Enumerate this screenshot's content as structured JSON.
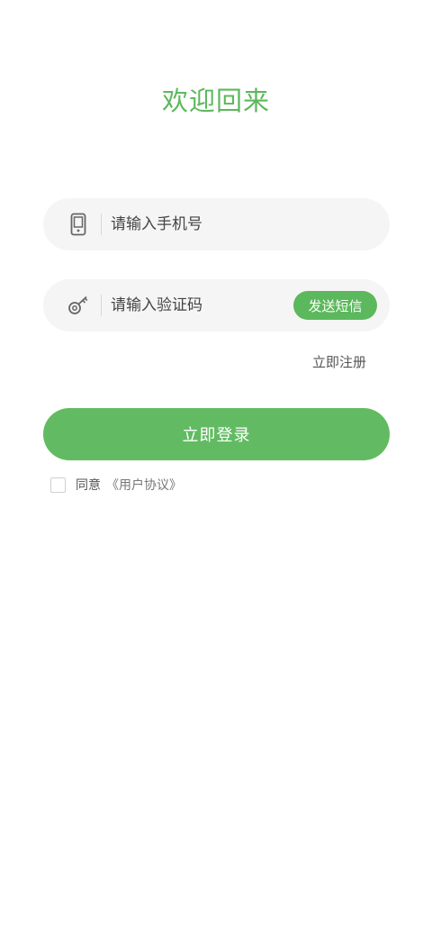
{
  "header": {
    "title": "欢迎回来"
  },
  "form": {
    "phone": {
      "icon": "phone-icon",
      "placeholder": "请输入手机号",
      "value": ""
    },
    "code": {
      "icon": "key-icon",
      "placeholder": "请输入验证码",
      "value": "",
      "send_sms_label": "发送短信"
    },
    "register_label": "立即注册",
    "login_label": "立即登录",
    "agreement": {
      "checked": false,
      "prefix": "同意",
      "link_label": "《用户协议》"
    }
  },
  "colors": {
    "accent": "#5cb85c",
    "field_bg": "#f5f5f5"
  }
}
